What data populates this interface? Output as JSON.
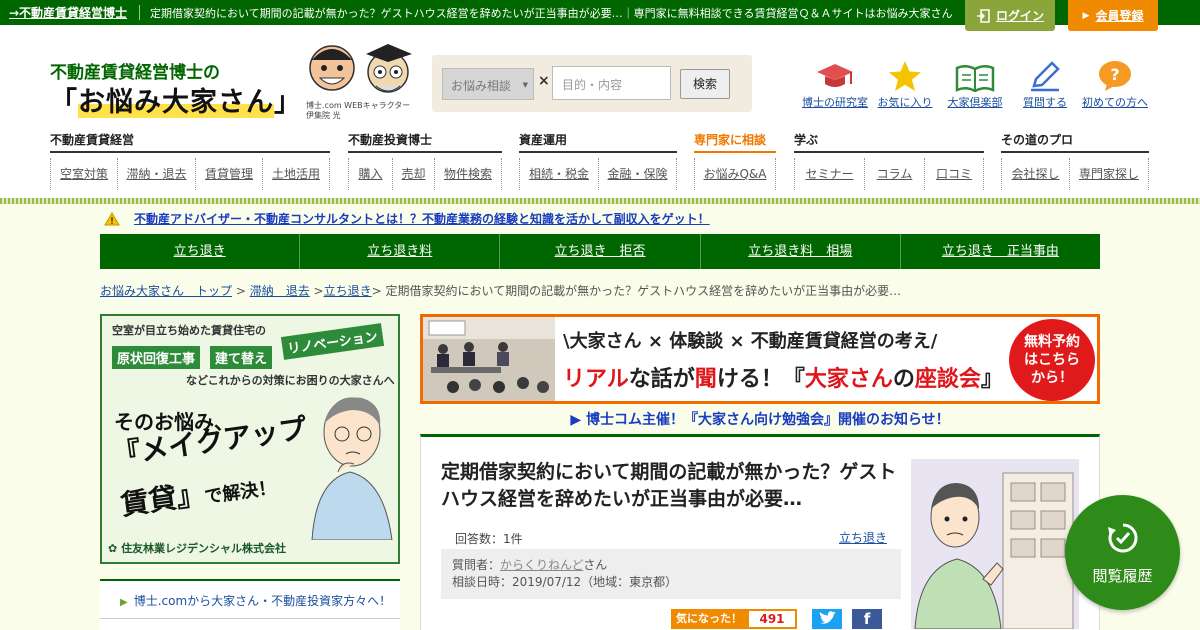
{
  "topbar": {
    "home_link": "→不動産賃貸経営博士",
    "description": "定期借家契約において期間の記載が無かった？ゲストハウス経営を辞めたいが正当事由が必要…｜専門家に無料相談できる賃貸経営Ｑ＆Ａサイトはお悩み大家さん",
    "login": "ログイン",
    "register": "会員登録"
  },
  "logo": {
    "sub": "不動産賃貸経営博士の",
    "main": "お悩み大家さん",
    "mascot_caption_1": "博士.com WEBキャラクター",
    "mascot_caption_2": "伊集院 光"
  },
  "search": {
    "category": "お悩み相談",
    "times": "×",
    "placeholder": "目的・内容",
    "button": "検索"
  },
  "quick_links": [
    {
      "label": "博士の研究室",
      "icon": "hat-icon"
    },
    {
      "label": "お気に入り",
      "icon": "star-icon"
    },
    {
      "label": "大家倶楽部",
      "icon": "book-icon"
    },
    {
      "label": "質問する",
      "icon": "pen-icon"
    },
    {
      "label": "初めての方へ",
      "icon": "question-icon"
    }
  ],
  "categories": [
    {
      "head": "不動産賃貸経営",
      "items": [
        "空室対策",
        "滞納・退去",
        "賃貸管理",
        "土地活用"
      ]
    },
    {
      "head": "不動産投資博士",
      "items": [
        "購入",
        "売却",
        "物件検索"
      ]
    },
    {
      "head": "資産運用",
      "items": [
        "相続・税金",
        "金融・保険"
      ]
    },
    {
      "head": "専門家に相談",
      "items": [
        "お悩みQ&A"
      ]
    },
    {
      "head": "学ぶ",
      "items": [
        "セミナー",
        "コラム",
        "口コミ"
      ]
    },
    {
      "head": "その道のプロ",
      "items": [
        "会社探し",
        "専門家探し"
      ]
    }
  ],
  "notice": "不動産アドバイザー・不動産コンサルタントとは！？不動産業務の経験と知識を活かして副収入をゲット！",
  "tags": [
    "立ち退き",
    "立ち退き料",
    "立ち退き　拒否",
    "立ち退き料　相場",
    "立ち退き　正当事由"
  ],
  "breadcrumb": {
    "top": "お悩み大家さん　トップ",
    "sep1": " > ",
    "cat": "滞納　退去",
    "sep2": " >",
    "sub": "立ち退き",
    "current": "> 定期借家契約において期間の記載が無かった？ゲストハウス経営を辞めたいが正当事由が必要…"
  },
  "ad_left": {
    "line1": "空室が目立ち始めた賃貸住宅の",
    "tag1": "原状回復工事",
    "tag2": "建て替え",
    "tag3": "リノベーション",
    "line3": "などこれからの対策にお困りの大家さんへ",
    "big1": "そのお悩み、",
    "big2": "『メイクアップ",
    "big3": "賃貸』",
    "big3b": "で解決！",
    "company": "住友林業レジデンシャル株式会社"
  },
  "sidebar": {
    "row1": "博士.comから大家さん・不動産投資家方々へ！"
  },
  "banner": {
    "h1": "\\大家さん × 体験談 × 不動産賃貸経営の考え/",
    "h2a": "リアル",
    "h2b": "な話が",
    "h2c": "聞",
    "h2d": "ける！『",
    "h2e": "大家さん",
    "h2f": "の",
    "h2g": "座談会",
    "h2h": "』",
    "circle_1": "無料予約",
    "circle_2": "はこちら",
    "circle_3": "から！"
  },
  "study_notice": "▶ 博士コム主催！『大家さん向け勉強会』開催のお知らせ！",
  "question": {
    "title": "定期借家契約において期間の記載が無かった？ゲストハウス経営を辞めたいが正当事由が必要…",
    "answers": "回答数：1件",
    "tag": "立ち退き",
    "asker_label": "質問者：",
    "asker": "からくりねんど",
    "asker_suffix": "さん",
    "date": "相談日時：2019/07/12（地域：東京都）",
    "interest_label": "気になった！",
    "interest_count": "491",
    "facebook": "f"
  },
  "history": "閲覧履歴",
  "colors": {
    "brand_green": "#006600",
    "accent_orange": "#f08a00",
    "link_blue": "#1a4fa0"
  }
}
